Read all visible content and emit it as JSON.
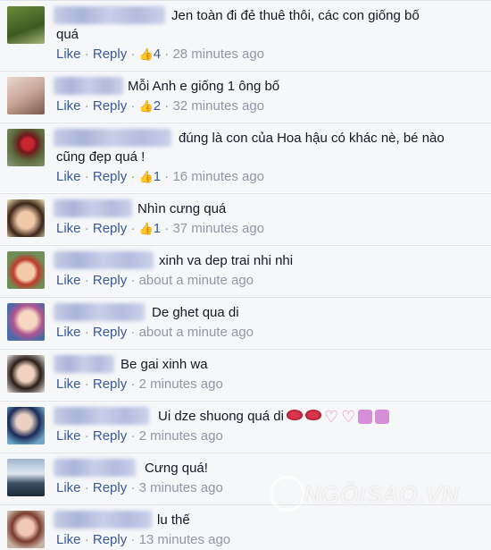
{
  "actions": {
    "like": "Like",
    "reply": "Reply",
    "sep": "·"
  },
  "comments": [
    {
      "text1": "Jen toàn đi đẻ thuê thôi, các con giống bố",
      "text2": "quá",
      "likes": "4",
      "time": "28 minutes ago"
    },
    {
      "text1": "Mỗi Anh e giống 1 ông bố",
      "text2": "",
      "likes": "2",
      "time": "32 minutes ago"
    },
    {
      "text1": "đúng là con của Hoa hậu có khác nè, bé nào",
      "text2": "cũng đẹp quá !",
      "likes": "1",
      "time": "16 minutes ago"
    },
    {
      "text1": "Nhìn cưng quá",
      "text2": "",
      "likes": "1",
      "time": "37 minutes ago"
    },
    {
      "text1": "xinh va dep trai nhi nhi",
      "text2": "",
      "likes": "",
      "time": "about a minute ago"
    },
    {
      "text1": "De ghet qua di",
      "text2": "",
      "likes": "",
      "time": "about a minute ago"
    },
    {
      "text1": "Be gai xinh wa",
      "text2": "",
      "likes": "",
      "time": "2 minutes ago"
    },
    {
      "text1": "Ui dze shuong quá di",
      "text2": "",
      "likes": "",
      "time": "2 minutes ago"
    },
    {
      "text1": "Cưng quá!",
      "text2": "",
      "likes": "",
      "time": "3 minutes ago"
    },
    {
      "text1": "lu thế",
      "text2": "",
      "likes": "",
      "time": "13 minutes ago"
    }
  ],
  "watermark": "NGÔISAO.VN",
  "icons": {
    "like_thumb": "thumbs-up-icon"
  }
}
